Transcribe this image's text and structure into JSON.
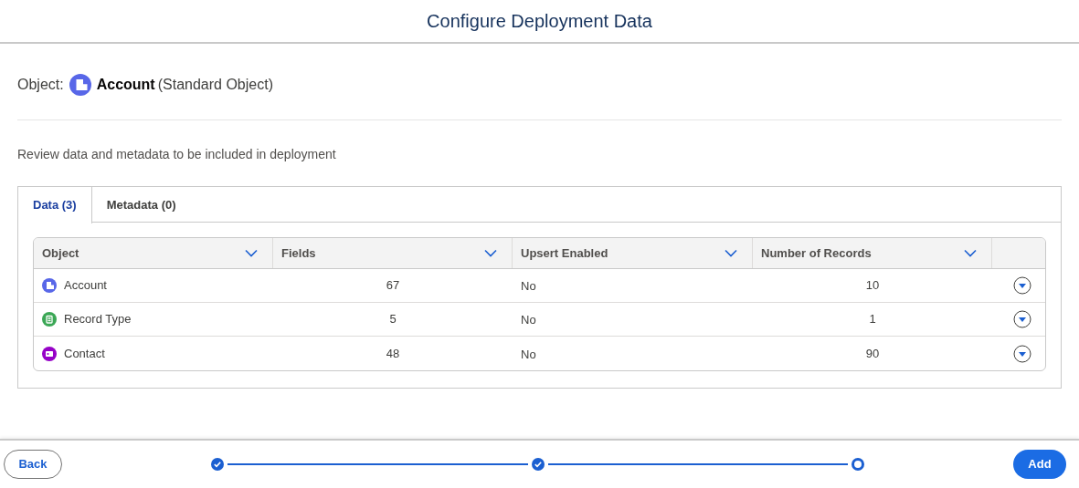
{
  "header": {
    "title": "Configure Deployment Data"
  },
  "object": {
    "label": "Object:",
    "name": "Account",
    "type": "(Standard Object)",
    "color": "#5867e8"
  },
  "description": "Review data and metadata to be included in deployment",
  "tabs": [
    {
      "label": "Data (3)",
      "selected": true
    },
    {
      "label": "Metadata (0)",
      "selected": false
    }
  ],
  "table": {
    "columns": [
      "Object",
      "Fields",
      "Upsert Enabled",
      "Number of Records"
    ],
    "rows": [
      {
        "object": "Account",
        "kind": "building",
        "color": "#5867e8",
        "fields": "67",
        "upsert_enabled": "No",
        "number_of_records": "10"
      },
      {
        "object": "Record Type",
        "kind": "clipboard",
        "color": "#3ba755",
        "fields": "5",
        "upsert_enabled": "No",
        "number_of_records": "1"
      },
      {
        "object": "Contact",
        "kind": "card",
        "color": "#9602c7",
        "fields": "48",
        "upsert_enabled": "No",
        "number_of_records": "90"
      }
    ]
  },
  "footer": {
    "back": "Back",
    "add": "Add",
    "steps": [
      {
        "completed": true
      },
      {
        "completed": true
      },
      {
        "completed": false
      }
    ]
  }
}
